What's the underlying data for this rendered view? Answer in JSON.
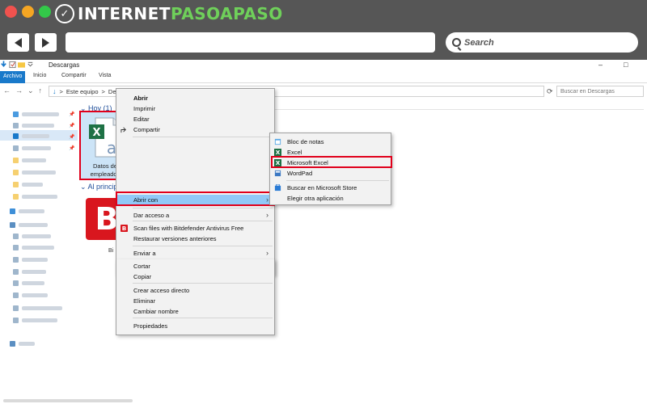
{
  "browser": {
    "logo": {
      "prefix": "INTERNET",
      "accent": "PASOAPASO"
    },
    "search_label": "Search",
    "colors": {
      "chrome": "#565656",
      "accent_green": "#6fd05a",
      "highlight_red": "#e0001b"
    }
  },
  "explorer": {
    "title": "Descargas",
    "window_controls": [
      "–",
      "□"
    ],
    "ribbon_tabs": [
      {
        "label": "Archivo",
        "active": true
      },
      {
        "label": "Inicio"
      },
      {
        "label": "Compartir"
      },
      {
        "label": "Vista"
      }
    ],
    "address": {
      "path": [
        "Este equipo",
        "Descargas"
      ],
      "separator": ">",
      "search_placeholder": "Buscar en Descargas"
    },
    "groups": [
      {
        "label": "Hoy (1)"
      },
      {
        "label": "Al principio"
      }
    ],
    "files": [
      {
        "name_line1": "Datos de",
        "name_line2": "empleados",
        "icon": "excel-file-icon",
        "selected": true
      },
      {
        "icon": "bitdefender-icon",
        "label": "Bi"
      }
    ]
  },
  "context_menu": {
    "items": [
      {
        "label": "Abrir",
        "bold": true
      },
      {
        "label": "Imprimir"
      },
      {
        "label": "Editar"
      },
      {
        "label": "Compartir",
        "icon": "share-icon"
      },
      {
        "sep": true
      },
      {
        "label": "Abrir con",
        "submenu": true,
        "highlighted": true
      },
      {
        "sep": true
      },
      {
        "label": "Dar acceso a",
        "submenu": true
      },
      {
        "sep": true
      },
      {
        "label": "Scan files with Bitdefender Antivirus Free",
        "icon": "bitdefender-icon"
      },
      {
        "label": "Restaurar versiones anteriores"
      },
      {
        "sep": true
      },
      {
        "label": "Enviar a",
        "submenu": true
      },
      {
        "sep": true
      },
      {
        "label": "Cortar"
      },
      {
        "label": "Copiar"
      },
      {
        "sep": true
      },
      {
        "label": "Crear acceso directo"
      },
      {
        "label": "Eliminar"
      },
      {
        "label": "Cambiar nombre"
      },
      {
        "sep": true
      },
      {
        "label": "Propiedades"
      }
    ]
  },
  "submenu": {
    "items": [
      {
        "label": "Bloc de notas",
        "icon": "notepad-icon"
      },
      {
        "label": "Excel",
        "icon": "excel-icon"
      },
      {
        "label": "Microsoft Excel",
        "icon": "excel-icon",
        "highlighted": true
      },
      {
        "label": "WordPad",
        "icon": "wordpad-icon"
      },
      {
        "sep": true
      },
      {
        "label": "Buscar en Microsoft Store",
        "icon": "store-icon"
      },
      {
        "label": "Elegir otra aplicación"
      }
    ]
  }
}
